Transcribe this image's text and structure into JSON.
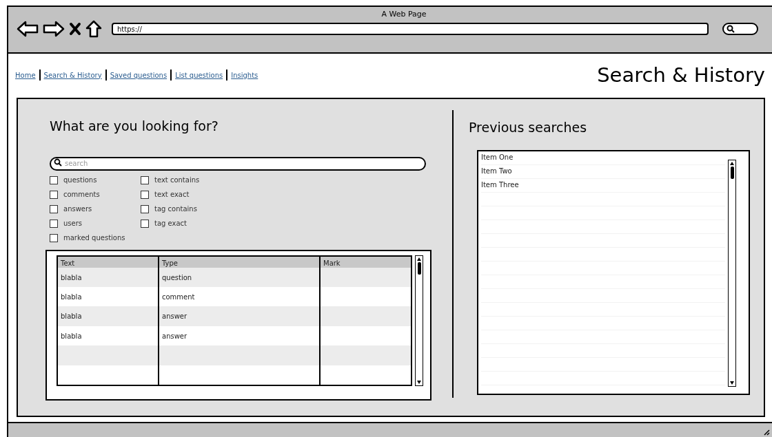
{
  "window": {
    "title": "A Web Page"
  },
  "address_bar": {
    "value": "https://"
  },
  "nav_links": [
    {
      "label": "Home"
    },
    {
      "label": "Search & History"
    },
    {
      "label": "Saved questions"
    },
    {
      "label": "List questions"
    },
    {
      "label": "Insights"
    }
  ],
  "page_title": "Search & History",
  "search_section": {
    "heading": "What are you looking for?",
    "search": {
      "placeholder": "search"
    },
    "filters": [
      {
        "label": "questions",
        "checked": false
      },
      {
        "label": "comments",
        "checked": false
      },
      {
        "label": "answers",
        "checked": false
      },
      {
        "label": "users",
        "checked": false
      },
      {
        "label": "marked questions",
        "checked": false
      },
      {
        "label": "text contains",
        "checked": false
      },
      {
        "label": "text exact",
        "checked": false
      },
      {
        "label": "tag contains",
        "checked": false
      },
      {
        "label": "tag exact",
        "checked": false
      }
    ]
  },
  "results_table": {
    "columns": [
      "Text",
      "Type",
      "Mark"
    ],
    "rows": [
      {
        "text": "blabla",
        "type": "question"
      },
      {
        "text": "blabla",
        "type": "comment"
      },
      {
        "text": "blabla",
        "type": "answer"
      },
      {
        "text": "blabla",
        "type": "answer"
      }
    ]
  },
  "previous_searches": {
    "heading": "Previous searches",
    "items": [
      "Item One",
      "Item Two",
      "Item Three"
    ]
  }
}
